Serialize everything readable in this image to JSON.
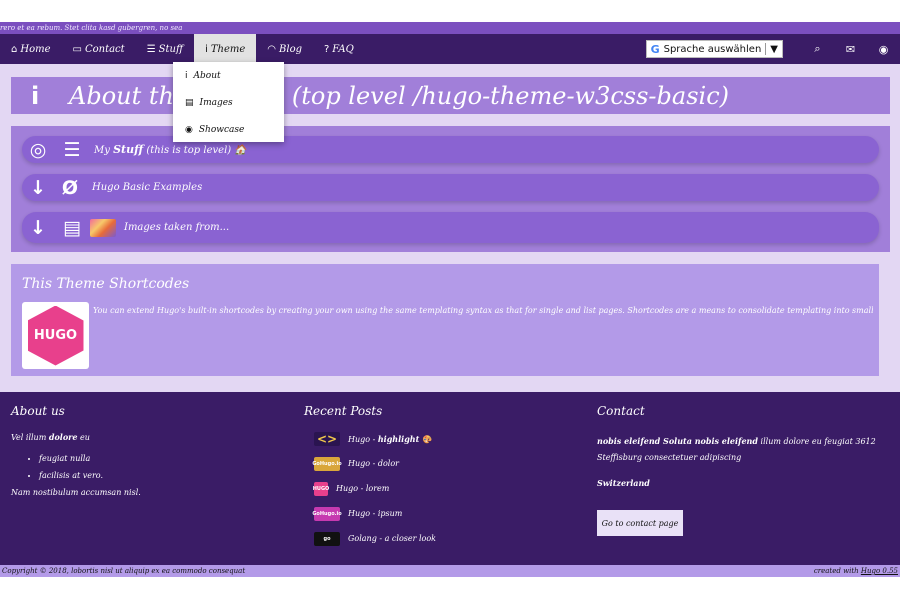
{
  "marquee": {
    "text": "rero et ea rebum. Stet clita kasd gubergren, no sea"
  },
  "nav": {
    "items": [
      {
        "icon": "⌂",
        "label": "Home"
      },
      {
        "icon": "▭",
        "label": "Contact"
      },
      {
        "icon": "☰",
        "label": "Stuff"
      },
      {
        "icon": "i",
        "label": "Theme"
      },
      {
        "icon": "◠",
        "label": "Blog"
      },
      {
        "icon": "?",
        "label": "FAQ"
      }
    ],
    "translate_label": "Sprache auswählen",
    "translate_arrow": "▼",
    "right_icons": [
      "⌕",
      "✉",
      "◉"
    ]
  },
  "dropdown": {
    "items": [
      {
        "icon": "i",
        "label": "About"
      },
      {
        "icon": "▤",
        "label": "Images"
      },
      {
        "icon": "◉",
        "label": "Showcase"
      }
    ]
  },
  "hero": {
    "icon": "i",
    "title": "About this Theme (top level /hugo-theme-w3css-basic)"
  },
  "list": {
    "item1": {
      "icon1": "◎",
      "icon2": "☰",
      "text": "My",
      "bold": "Stuff",
      "suffix": "(this is top level)",
      "emoji": "🏠"
    },
    "item2": {
      "icon1": "↓",
      "icon2": "Ø",
      "text": "Hugo Basic Examples"
    },
    "item3": {
      "icon1": "↓",
      "icon2": "▤",
      "text": "Images taken from..."
    }
  },
  "shortcodes": {
    "title": "This Theme Shortcodes",
    "logo_text": "HUGO",
    "text": "You can extend Hugo's built-in shortcodes by creating your own using the same templating syntax as that for single and list pages. Shortcodes are a means to consolidate templating into small, reusable ..."
  },
  "footer": {
    "about": {
      "title": "About us",
      "line1_a": "Vel illum",
      "line1_b": "dolore",
      "line1_c": "eu",
      "bullets": [
        "feugiat nulla",
        "facilisis at vero."
      ],
      "line2": "Nam nostibulum accumsan nisl."
    },
    "posts": {
      "title": "Recent Posts",
      "items": [
        {
          "label": "Hugo - ",
          "bold": "highlight",
          "emoji": "🎨",
          "thumb": "<>",
          "color": "#2a1450"
        },
        {
          "label": "Hugo - dolor",
          "bold": "",
          "emoji": "",
          "thumb": "GoHugo.io",
          "color": "#d9a63b"
        },
        {
          "label": "Hugo - lorem",
          "bold": "",
          "emoji": "",
          "thumb": "HUGO",
          "color": "#e8408c"
        },
        {
          "label": "Hugo - ipsum",
          "bold": "",
          "emoji": "",
          "thumb": "GoHugo.io",
          "color": "#c63ab0"
        },
        {
          "label": "Golang - a closer look",
          "bold": "",
          "emoji": "",
          "thumb": "go",
          "color": "#111111"
        }
      ]
    },
    "contact": {
      "title": "Contact",
      "addr_bold": "nobis eleifend Soluta nobis eleifend",
      "addr_rest": "illum dolore eu feugiat 3612 Steffisburg consectetuer adipiscing",
      "country": "Switzerland",
      "button": "Go to contact page"
    }
  },
  "bottom": {
    "copyright": "Copyright © 2018, lobortis nisl ut aliquip ex ea commodo consequat",
    "created_prefix": "created with",
    "created_link": "Hugo 0.55"
  }
}
